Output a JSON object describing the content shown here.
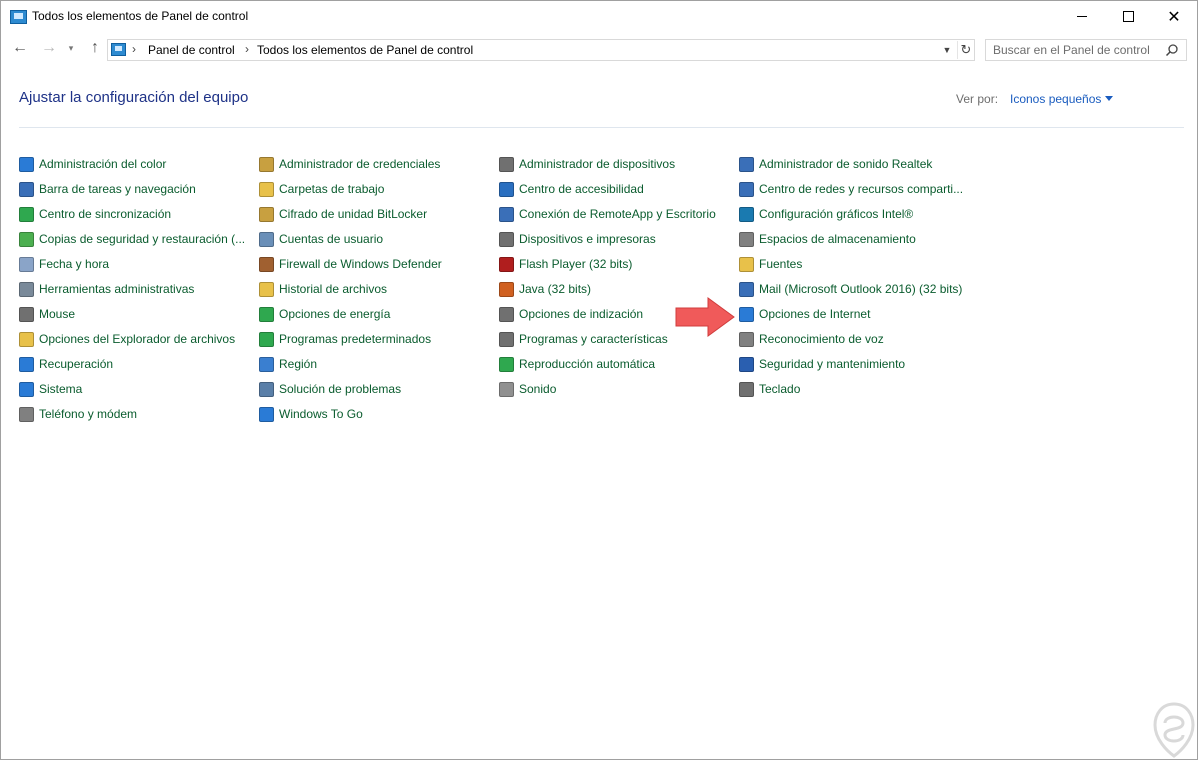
{
  "window": {
    "title": "Todos los elementos de Panel de control",
    "minimize_icon": "minimize-icon",
    "maximize_icon": "maximize-icon",
    "close_icon": "close-icon"
  },
  "nav": {
    "breadcrumbs": [
      "Panel de control",
      "Todos los elementos de Panel de control"
    ],
    "search_placeholder": "Buscar en el Panel de control"
  },
  "content": {
    "heading": "Ajustar la configuración del equipo",
    "view_by_label": "Ver por:",
    "view_by_value": "Iconos pequeños",
    "link_color": "#0a5c2e",
    "heading_color": "#1e3287",
    "columns": [
      [
        {
          "label": "Administración del color",
          "icon": "color-management-icon",
          "color": "#2a7bd6"
        },
        {
          "label": "Barra de tareas y navegación",
          "icon": "taskbar-icon",
          "color": "#3a6fb8"
        },
        {
          "label": "Centro de sincronización",
          "icon": "sync-center-icon",
          "color": "#2fa84f"
        },
        {
          "label": "Copias de seguridad y restauración (...",
          "icon": "backup-restore-icon",
          "color": "#4caf50"
        },
        {
          "label": "Fecha y hora",
          "icon": "date-time-icon",
          "color": "#8aa4c8"
        },
        {
          "label": "Herramientas administrativas",
          "icon": "admin-tools-icon",
          "color": "#7a8a9a"
        },
        {
          "label": "Mouse",
          "icon": "mouse-icon",
          "color": "#707070"
        },
        {
          "label": "Opciones del Explorador de archivos",
          "icon": "folder-options-icon",
          "color": "#e8c14a"
        },
        {
          "label": "Recuperación",
          "icon": "recovery-icon",
          "color": "#2a7bd6"
        },
        {
          "label": "Sistema",
          "icon": "system-icon",
          "color": "#2a7bd6"
        },
        {
          "label": "Teléfono y módem",
          "icon": "phone-modem-icon",
          "color": "#808080"
        }
      ],
      [
        {
          "label": "Administrador de credenciales",
          "icon": "credential-manager-icon",
          "color": "#c8a040"
        },
        {
          "label": "Carpetas de trabajo",
          "icon": "work-folders-icon",
          "color": "#e8c14a"
        },
        {
          "label": "Cifrado de unidad BitLocker",
          "icon": "bitlocker-icon",
          "color": "#c8a040"
        },
        {
          "label": "Cuentas de usuario",
          "icon": "user-accounts-icon",
          "color": "#6a8fb8"
        },
        {
          "label": "Firewall de Windows Defender",
          "icon": "firewall-icon",
          "color": "#a06030"
        },
        {
          "label": "Historial de archivos",
          "icon": "file-history-icon",
          "color": "#e8c14a"
        },
        {
          "label": "Opciones de energía",
          "icon": "power-options-icon",
          "color": "#2fa84f"
        },
        {
          "label": "Programas predeterminados",
          "icon": "default-programs-icon",
          "color": "#2fa84f"
        },
        {
          "label": "Región",
          "icon": "region-icon",
          "color": "#3a7fd0"
        },
        {
          "label": "Solución de problemas",
          "icon": "troubleshooting-icon",
          "color": "#5a7fa8"
        },
        {
          "label": "Windows To Go",
          "icon": "windows-to-go-icon",
          "color": "#2a7bd6"
        }
      ],
      [
        {
          "label": "Administrador de dispositivos",
          "icon": "device-manager-icon",
          "color": "#707070"
        },
        {
          "label": "Centro de accesibilidad",
          "icon": "ease-of-access-icon",
          "color": "#2a6fc0"
        },
        {
          "label": "Conexión de RemoteApp y Escritorio",
          "icon": "remoteapp-icon",
          "color": "#3a6fb8"
        },
        {
          "label": "Dispositivos e impresoras",
          "icon": "devices-printers-icon",
          "color": "#707070"
        },
        {
          "label": "Flash Player (32 bits)",
          "icon": "flash-player-icon",
          "color": "#b01e1e"
        },
        {
          "label": "Java (32 bits)",
          "icon": "java-icon",
          "color": "#d06020"
        },
        {
          "label": "Opciones de indización",
          "icon": "indexing-options-icon",
          "color": "#707070"
        },
        {
          "label": "Programas y características",
          "icon": "programs-features-icon",
          "color": "#707070"
        },
        {
          "label": "Reproducción automática",
          "icon": "autoplay-icon",
          "color": "#2fa84f"
        },
        {
          "label": "Sonido",
          "icon": "sound-icon",
          "color": "#909090"
        }
      ],
      [
        {
          "label": "Administrador de sonido Realtek",
          "icon": "realtek-audio-icon",
          "color": "#3a6fb8"
        },
        {
          "label": "Centro de redes y recursos comparti...",
          "icon": "network-sharing-icon",
          "color": "#3a6fb8"
        },
        {
          "label": "Configuración gráficos Intel®",
          "icon": "intel-graphics-icon",
          "color": "#1a7ab0"
        },
        {
          "label": "Espacios de almacenamiento",
          "icon": "storage-spaces-icon",
          "color": "#808080"
        },
        {
          "label": "Fuentes",
          "icon": "fonts-icon",
          "color": "#e8c14a"
        },
        {
          "label": "Mail (Microsoft Outlook 2016) (32 bits)",
          "icon": "mail-icon",
          "color": "#3a6fb8"
        },
        {
          "label": "Opciones de Internet",
          "icon": "internet-options-icon",
          "color": "#2a7bd6"
        },
        {
          "label": "Reconocimiento de voz",
          "icon": "speech-recognition-icon",
          "color": "#808080"
        },
        {
          "label": "Seguridad y mantenimiento",
          "icon": "security-maintenance-icon",
          "color": "#2a5fb0"
        },
        {
          "label": "Teclado",
          "icon": "keyboard-icon",
          "color": "#707070"
        }
      ]
    ]
  },
  "annotation": {
    "arrow_color": "#f05a5a",
    "arrow_icon": "red-arrow-icon"
  }
}
